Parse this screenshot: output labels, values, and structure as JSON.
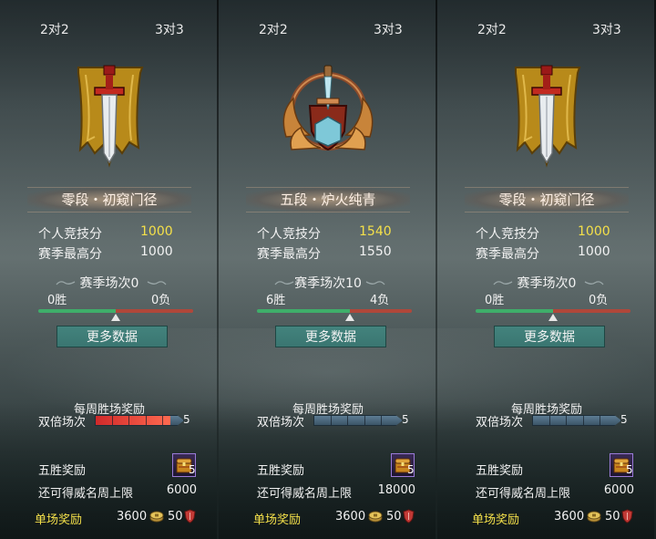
{
  "panels": [
    {
      "tabs": {
        "left": "2对2",
        "right": "3对3"
      },
      "rank_name": "零段・初窥门径",
      "emblem": "banner-sword-icon",
      "personal_label": "个人竞技分",
      "personal_score": "1000",
      "season_high_label": "赛季最高分",
      "season_high": "1000",
      "season_matches": "赛季场次0",
      "wins": "0胜",
      "losses": "0负",
      "win_ratio": 0.5,
      "more_button": "更多数据",
      "weekly_title": "每周胜场奖励",
      "double_label": "双倍场次",
      "double_count": "5",
      "double_progress": 0.85,
      "double_fill_color": "#e03a30",
      "five_win_label": "五胜奖励",
      "chest_count": "5",
      "cap_label": "还可得威名周上限",
      "cap_value": "6000",
      "single_label": "单场奖励",
      "single_coins": "3600",
      "single_shield": "50"
    },
    {
      "tabs": {
        "left": "2对2",
        "right": "3对3"
      },
      "rank_name": "五段・炉火纯青",
      "emblem": "winged-shield-sword-icon",
      "personal_label": "个人竞技分",
      "personal_score": "1540",
      "season_high_label": "赛季最高分",
      "season_high": "1550",
      "season_matches": "赛季场次10",
      "wins": "6胜",
      "losses": "4负",
      "win_ratio": 0.6,
      "more_button": "更多数据",
      "weekly_title": "每周胜场奖励",
      "double_label": "双倍场次",
      "double_count": "5",
      "double_progress": 0,
      "double_fill_color": "#e03a30",
      "five_win_label": "五胜奖励",
      "chest_count": "5",
      "cap_label": "还可得威名周上限",
      "cap_value": "18000",
      "single_label": "单场奖励",
      "single_coins": "3600",
      "single_shield": "50"
    },
    {
      "tabs": {
        "left": "2对2",
        "right": "3对3"
      },
      "rank_name": "零段・初窥门径",
      "emblem": "banner-sword-icon",
      "personal_label": "个人竞技分",
      "personal_score": "1000",
      "season_high_label": "赛季最高分",
      "season_high": "1000",
      "season_matches": "赛季场次0",
      "wins": "0胜",
      "losses": "0负",
      "win_ratio": 0.5,
      "more_button": "更多数据",
      "weekly_title": "每周胜场奖励",
      "double_label": "双倍场次",
      "double_count": "5",
      "double_progress": 0,
      "double_fill_color": "#e03a30",
      "five_win_label": "五胜奖励",
      "chest_count": "5",
      "cap_label": "还可得威名周上限",
      "cap_value": "6000",
      "single_label": "单场奖励",
      "single_coins": "3600",
      "single_shield": "50"
    }
  ],
  "colors": {
    "score_yellow": "#f4e04a",
    "win_green": "#3fae6a",
    "lose_red": "#b0473a",
    "button_teal": "#3a7671"
  }
}
